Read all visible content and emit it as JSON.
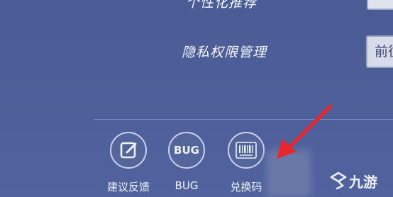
{
  "settings": {
    "top_row_label": "个性化推荐",
    "privacy": {
      "label": "隐私权限管理",
      "button_label": "前往"
    }
  },
  "actions": [
    {
      "icon": "edit-icon",
      "label": "建议反馈"
    },
    {
      "icon": "bug-icon",
      "icon_text": "BUG",
      "label": "BUG"
    },
    {
      "icon": "barcode-icon",
      "label": "兑换码"
    }
  ],
  "overlay": {
    "arrow_color": "#e8262c",
    "watermark": "九游",
    "watermark_logo": "nine-game-logo"
  }
}
